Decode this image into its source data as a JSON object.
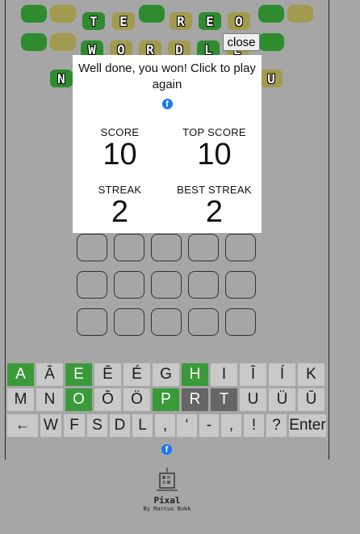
{
  "title_tiles": {
    "row1": [
      {
        "letter": "T",
        "color": "green"
      },
      {
        "letter": "E",
        "color": "olive"
      },
      {
        "letter": "R",
        "color": "olive"
      },
      {
        "letter": "E",
        "color": "green"
      },
      {
        "letter": "O",
        "color": "olive"
      }
    ],
    "row2": [
      {
        "letter": "W",
        "color": "green"
      },
      {
        "letter": "O",
        "color": "olive"
      },
      {
        "letter": "R",
        "color": "olive"
      },
      {
        "letter": "D",
        "color": "olive"
      },
      {
        "letter": "L",
        "color": "green"
      },
      {
        "letter": "E",
        "color": "olive"
      }
    ],
    "row3_left": "N",
    "row3_right": "U"
  },
  "modal": {
    "close_label": "close",
    "message": "Well done, you won! Click to play again",
    "score_label": "SCORE",
    "score_value": "10",
    "top_score_label": "TOP SCORE",
    "top_score_value": "10",
    "streak_label": "STREAK",
    "streak_value": "2",
    "best_streak_label": "BEST STREAK",
    "best_streak_value": "2",
    "facebook_icon": "facebook-icon"
  },
  "keyboard": {
    "row1": [
      {
        "k": "A",
        "state": "correct"
      },
      {
        "k": "Ā",
        "state": ""
      },
      {
        "k": "E",
        "state": "correct"
      },
      {
        "k": "Ē",
        "state": ""
      },
      {
        "k": "É",
        "state": ""
      },
      {
        "k": "G",
        "state": ""
      },
      {
        "k": "H",
        "state": "correct"
      },
      {
        "k": "I",
        "state": ""
      },
      {
        "k": "Ī",
        "state": ""
      },
      {
        "k": "Í",
        "state": ""
      },
      {
        "k": "K",
        "state": ""
      }
    ],
    "row2": [
      {
        "k": "M",
        "state": ""
      },
      {
        "k": "N",
        "state": ""
      },
      {
        "k": "O",
        "state": "correct"
      },
      {
        "k": "Ō",
        "state": ""
      },
      {
        "k": "Ö",
        "state": ""
      },
      {
        "k": "P",
        "state": "correct"
      },
      {
        "k": "R",
        "state": "used"
      },
      {
        "k": "T",
        "state": "used"
      },
      {
        "k": "U",
        "state": ""
      },
      {
        "k": "Ü",
        "state": ""
      },
      {
        "k": "Ū",
        "state": ""
      }
    ],
    "row3": [
      "←",
      "W",
      "F",
      "S",
      "D",
      "L",
      ",",
      "‘",
      "-",
      ",",
      "!",
      "?",
      "Enter"
    ]
  },
  "footer": {
    "logo_name": "Pixal",
    "logo_by": "By Marcus Bokk"
  },
  "colors": {
    "green": "#2e8b2e",
    "olive": "#a29a4e",
    "key_correct": "#3a9a3a",
    "key_used": "#666666",
    "facebook": "#1877f2"
  }
}
